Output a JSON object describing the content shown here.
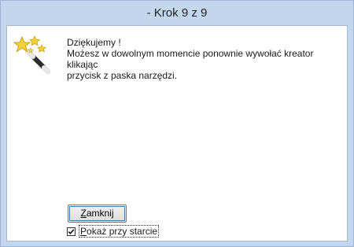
{
  "window": {
    "title": "- Krok 9 z 9"
  },
  "message": {
    "line1": "Dziękujemy !",
    "line2": "Możesz w dowolnym momencie ponownie wywołać kreator klikając",
    "line3": "przycisk z paska narzędzi."
  },
  "buttons": {
    "close_label_mnemonic": "Z",
    "close_label_rest": "amknij"
  },
  "startup_checkbox": {
    "checked": true,
    "label_mnemonic": "P",
    "label_rest": "okaż przy starcie"
  },
  "icons": {
    "wizard": "magic-wand-icon",
    "check": "checkmark-icon"
  },
  "colors": {
    "frame": "#c2d7ee",
    "button_focus": "#3c7fb1",
    "star": "#f5d23a"
  }
}
